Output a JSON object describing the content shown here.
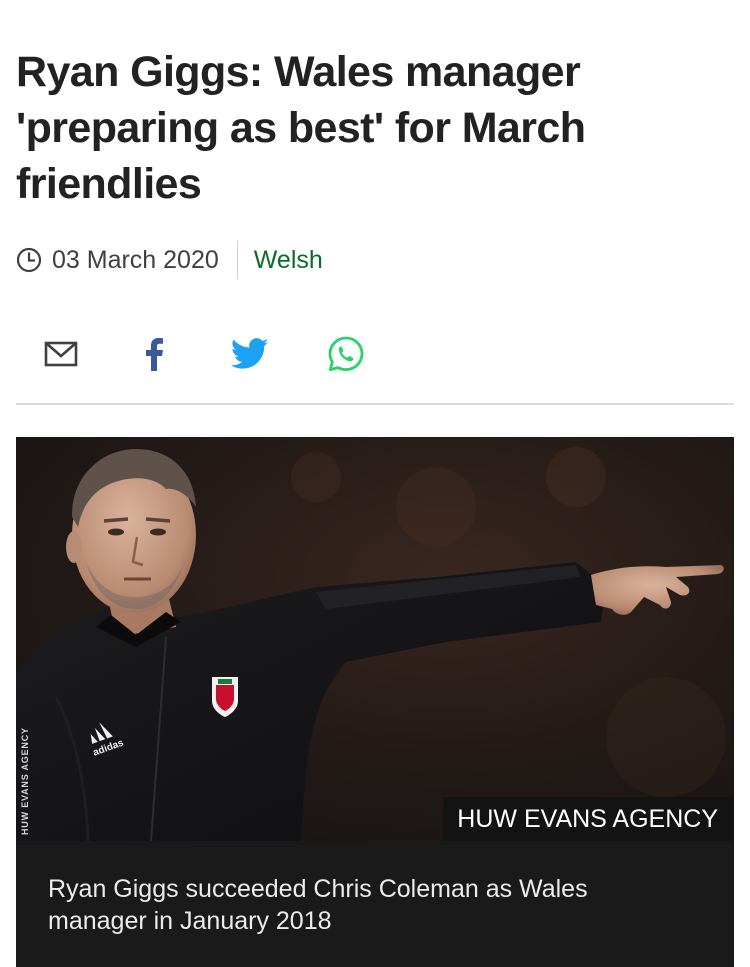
{
  "article": {
    "headline": "Ryan Giggs: Wales manager 'preparing as best' for March friendlies",
    "date": "03 March 2020",
    "language_link": "Welsh"
  },
  "share": {
    "items": [
      {
        "name": "email",
        "icon": "envelope-icon"
      },
      {
        "name": "facebook",
        "icon": "facebook-icon"
      },
      {
        "name": "twitter",
        "icon": "twitter-icon"
      },
      {
        "name": "whatsapp",
        "icon": "whatsapp-icon"
      }
    ]
  },
  "image": {
    "credit_badge": "HUW EVANS AGENCY",
    "side_credit": "HUW EVANS AGENCY",
    "caption": "Ryan Giggs succeeded Chris Coleman as Wales manager in January 2018",
    "logo_text": "adidas"
  },
  "colors": {
    "headline": "#222222",
    "date": "#404040",
    "language_link": "#0a6b2a",
    "facebook": "#3b5998",
    "twitter": "#1da1f2",
    "whatsapp": "#25d366",
    "caption_background": "#1a1a1a",
    "caption_text": "#ececec"
  }
}
